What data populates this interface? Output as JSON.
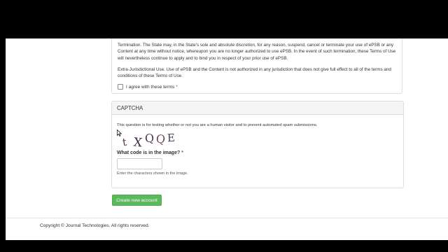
{
  "terms": {
    "termination": "Termination. The State may, in the State's sole and absolute discretion, for any reason, suspend, cancel or terminate your use of ePSB or any Content at any time without notice, whereupon you are no longer authorized to use ePSB. In the event of such termination, these Terms of Use will nevertheless continue to apply and to bind you in respect of your prior use of ePSB.",
    "extra_jurisdictional": "Extra-Jurisdictional Use. Use of ePSB and the Content is not authorized in any jurisdiction that does not give full effect to all of the terms and conditions of these Terms of Use.",
    "agree_label": "I agree with these terms",
    "required_mark": "*"
  },
  "captcha": {
    "heading": "CAPTCHA",
    "description": "This question is for testing whether or not you are a human visitor and to prevent automated spam submissions.",
    "image_text": "tXQQE",
    "question": "What code is in the image?",
    "required_mark": "*",
    "input_value": "",
    "help": "Enter the characters shown in the image."
  },
  "actions": {
    "create_account": "Create new account"
  },
  "footer": {
    "copyright": "Copyright © Journal Technologies. All rights reserved."
  },
  "colors": {
    "button_green": "#5cb85c",
    "panel_border": "#dddddd",
    "panel_heading_bg": "#f5f5f5",
    "required_red": "#a94442"
  }
}
